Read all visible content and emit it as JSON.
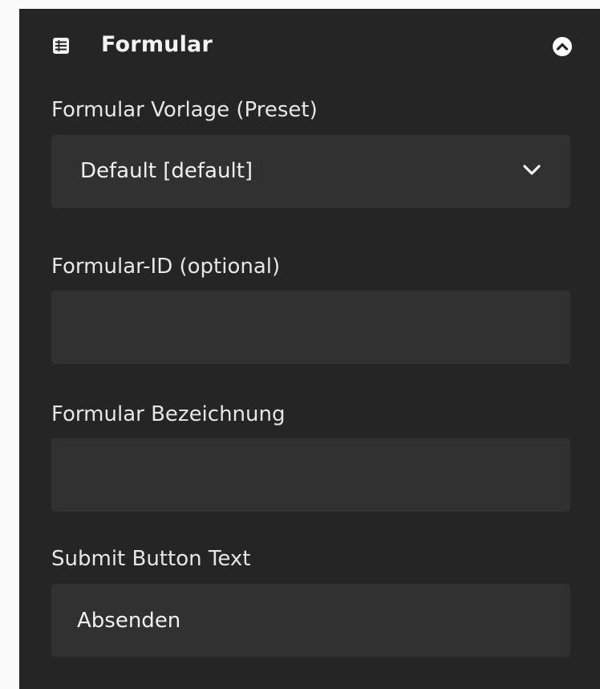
{
  "panel": {
    "title": "Formular",
    "header_icon": "form-list-icon",
    "collapse_icon": "chevron-up-circle-icon"
  },
  "fields": {
    "preset": {
      "label": "Formular Vorlage (Preset)",
      "value": "Default [default]",
      "icon": "chevron-down-icon"
    },
    "form_id": {
      "label": "Formular-ID (optional)",
      "value": "",
      "placeholder": ""
    },
    "form_name": {
      "label": "Formular Bezeichnung",
      "value": "",
      "placeholder": ""
    },
    "submit_text": {
      "label": "Submit Button Text",
      "value": "Absenden",
      "placeholder": ""
    }
  },
  "colors": {
    "panel_background": "#252525",
    "field_background": "#313131",
    "text": "#f0f0f0",
    "page_background": "#fbfbfb"
  }
}
